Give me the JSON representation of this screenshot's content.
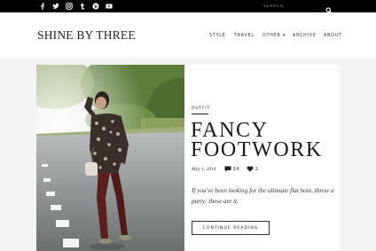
{
  "topbar": {
    "social_icons": [
      "facebook-icon",
      "twitter-icon",
      "instagram-icon",
      "tumblr-icon",
      "pinterest-icon",
      "youtube-icon"
    ],
    "search": {
      "placeholder": "SEARCH",
      "icon": "search-icon"
    }
  },
  "header": {
    "brand": "SHINE BY THREE",
    "nav": [
      {
        "label": "STYLE"
      },
      {
        "label": "TRAVEL"
      },
      {
        "label": "OTHER ▾"
      },
      {
        "label": "ARCHIVE"
      },
      {
        "label": "ABOUT"
      }
    ]
  },
  "post": {
    "category": "OUTFIT",
    "title": "FANCY FOOTWORK",
    "date": "May 1, 2014",
    "comments": "14",
    "likes": "2",
    "excerpt": "If you've been looking for the ultimate flat boot, throw a party: these are it.",
    "button": "CONTINUE READING"
  },
  "colors": {
    "topbar": "#000000",
    "band": "#f4f4f4",
    "text": "#1a1a1a"
  }
}
